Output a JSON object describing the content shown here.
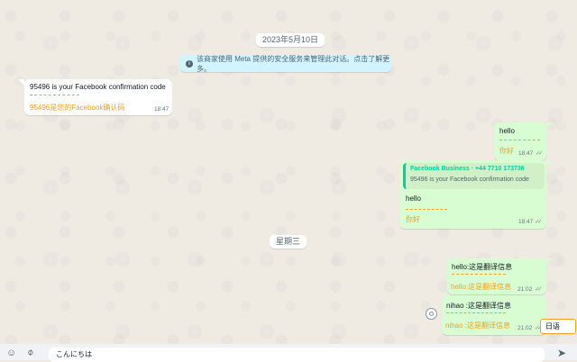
{
  "date_chip": "2023年5月10日",
  "weekday_chip": "星期三",
  "notice": {
    "text": "该商家使用 Meta 提供的安全服务来管理此对话。点击了解更多。",
    "icon": "info-icon"
  },
  "messages": {
    "m1": {
      "text": "95496 is your Facebook confirmation code",
      "translation": "95496是您的Facebook确认码",
      "time": "18:47"
    },
    "m2": {
      "text": "hello",
      "translation": "你好",
      "time": "18:47"
    },
    "m3": {
      "quote_name": "Facebook Business · +44 7710 173736",
      "quote_text": "95496 is your Facebook confirmation code",
      "text": "hello",
      "translation": "你好",
      "time": "18:47"
    },
    "m4": {
      "text": "hello:这是翻译信息",
      "translation": "hello:这是翻译信息",
      "time": "21:02"
    },
    "m5": {
      "text": "nihao :这是翻译信息",
      "translation": "nihao :这是翻译信息",
      "time": "21:02"
    }
  },
  "language_button": "日语",
  "composer": {
    "input_value": "こんにちは",
    "icons": [
      "emoji-icon",
      "attach-icon",
      "send-icon"
    ]
  },
  "colors": {
    "wallpaper": "#efeae2",
    "incoming": "#ffffff",
    "outgoing": "#d9fdd3",
    "translation": "#f0a020",
    "notice": "#d1f4ff"
  }
}
